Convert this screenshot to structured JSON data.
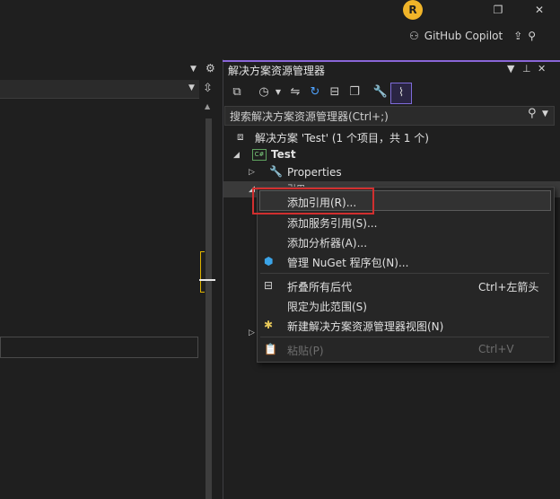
{
  "titlebar": {
    "avatar_letter": "R",
    "restore_glyph": "❐",
    "close_glyph": "✕",
    "copilot_label": "GitHub Copilot"
  },
  "solution_explorer": {
    "title": "解决方案资源管理器",
    "search_placeholder": "搜索解决方案资源管理器(Ctrl+;)",
    "tree": {
      "solution_label": "解决方案 'Test' (1 个项目，共 1 个)",
      "project_label": "Test",
      "properties_label": "Properties",
      "references_label": "引用"
    }
  },
  "context_menu": {
    "items": [
      {
        "label": "添加引用(R)...",
        "shortcut": "",
        "icon": "",
        "disabled": false
      },
      {
        "label": "添加服务引用(S)...",
        "shortcut": "",
        "icon": "",
        "disabled": false
      },
      {
        "label": "添加分析器(A)...",
        "shortcut": "",
        "icon": "",
        "disabled": false
      },
      {
        "label": "管理 NuGet 程序包(N)...",
        "shortcut": "",
        "icon": "nuget-icon",
        "disabled": false
      },
      {
        "label": "折叠所有后代",
        "shortcut": "Ctrl+左箭头",
        "icon": "collapse-icon",
        "disabled": false
      },
      {
        "label": "限定为此范围(S)",
        "shortcut": "",
        "icon": "",
        "disabled": false
      },
      {
        "label": "新建解决方案资源管理器视图(N)",
        "shortcut": "",
        "icon": "new-view-icon",
        "disabled": false
      },
      {
        "label": "粘贴(P)",
        "shortcut": "Ctrl+V",
        "icon": "paste-icon",
        "disabled": true
      }
    ]
  },
  "colors": {
    "accent": "#8a66d8",
    "highlight_border": "#d12f2f",
    "avatar": "#f0b429"
  }
}
